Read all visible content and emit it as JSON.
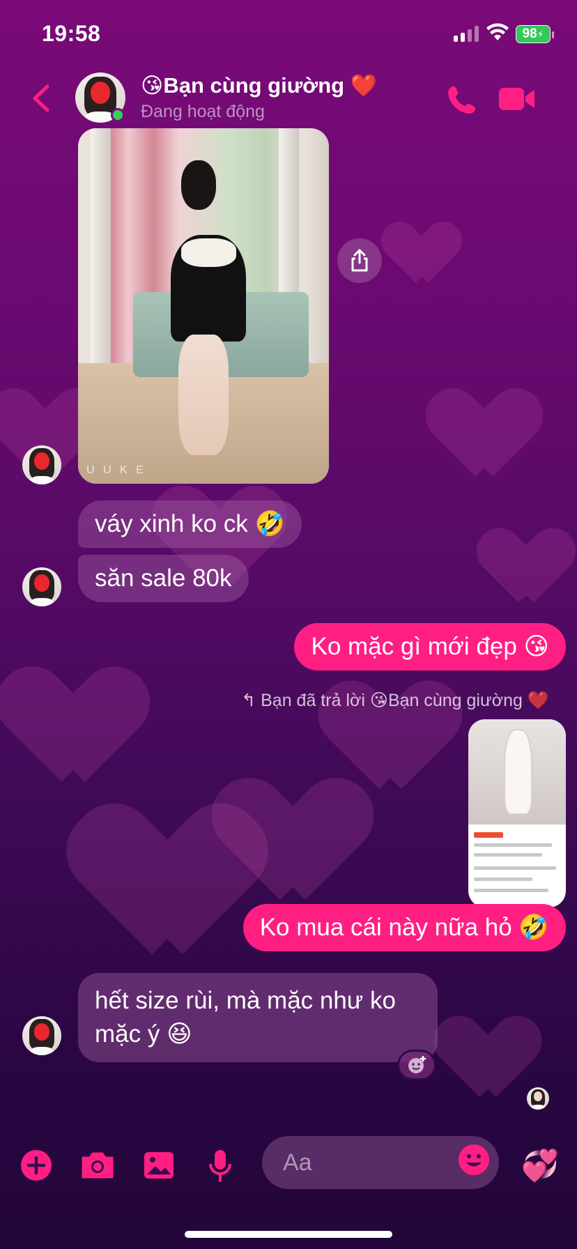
{
  "status_bar": {
    "time": "19:58",
    "battery": "98"
  },
  "header": {
    "back_icon": "chevron-left-icon",
    "title": "😘Bạn cùng giường ❤️",
    "subtitle": "Đang hoạt động",
    "call_icon": "phone-icon",
    "video_icon": "video-camera-icon",
    "accent": "#ff1f83"
  },
  "messages": {
    "photo_watermark": "U U K E",
    "m1": "váy xinh ko ck 🤣",
    "m2": "săn sale 80k",
    "m3": "Ko mặc gì mới đẹp 😘",
    "reply_note": "Bạn đã trả lời 😘Bạn cùng giường ❤️",
    "m4": "Ko mua cái này nữa hỏ 🤣",
    "m5_line1": "hết size rùi, mà mặc như ko",
    "m5_line2": "mặc ý 😆"
  },
  "composer": {
    "placeholder": "Aa",
    "like_emoji": "💞"
  },
  "colors": {
    "outgoing_bubble": "#ff1f83",
    "incoming_bubble": "#9a4e9a",
    "online_dot": "#31d158"
  }
}
